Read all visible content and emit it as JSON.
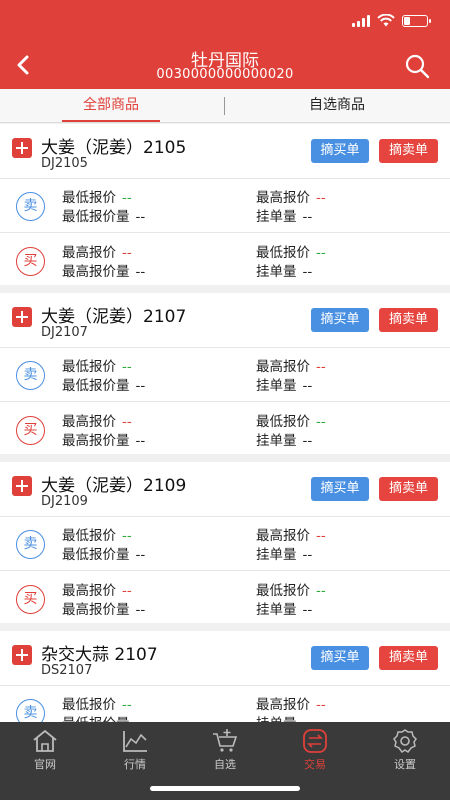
{
  "header": {
    "title": "牡丹国际",
    "account": "0030000000000020"
  },
  "tabs": [
    "全部商品",
    "自选商品"
  ],
  "buttons": {
    "buy": "摘买单",
    "sell": "摘卖单"
  },
  "labels": {
    "sell_badge": "卖",
    "buy_badge": "买",
    "low_price": "最低报价",
    "high_price": "最高报价",
    "low_qty": "最低报价量",
    "order_qty": "挂单量",
    "high_qty": "最高报价量"
  },
  "products": [
    {
      "name": "大姜（泥姜）2105",
      "code": "DJ2105"
    },
    {
      "name": "大姜（泥姜）2107",
      "code": "DJ2107"
    },
    {
      "name": "大姜（泥姜）2109",
      "code": "DJ2109"
    },
    {
      "name": "杂交大蒜 2107",
      "code": "DS2107"
    }
  ],
  "placeholder_value": "--",
  "nav": [
    {
      "label": "官网",
      "icon": "home-icon"
    },
    {
      "label": "行情",
      "icon": "chart-icon"
    },
    {
      "label": "自选",
      "icon": "cart-icon"
    },
    {
      "label": "交易",
      "icon": "exchange-icon"
    },
    {
      "label": "设置",
      "icon": "gear-icon"
    }
  ],
  "colors": {
    "brand": "#e0403a",
    "buy_blue": "#4a90e2",
    "green": "#2eaa3a",
    "nav_bg": "#3a3a3a"
  }
}
